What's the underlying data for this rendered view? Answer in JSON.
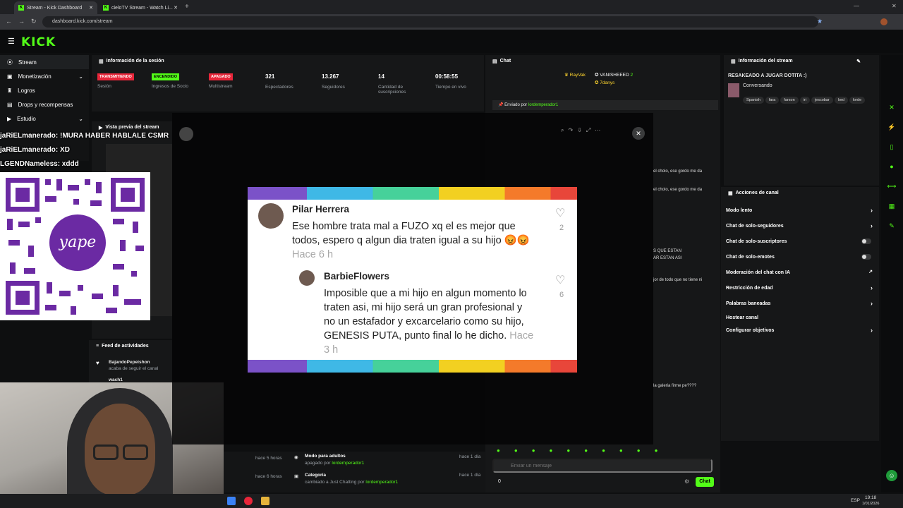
{
  "browser": {
    "tabs": [
      {
        "title": "Stream - Kick Dashboard",
        "active": true
      },
      {
        "title": "cieloTV Stream - Watch Li...",
        "active": false
      }
    ],
    "url": "dashboard.kick.com/stream"
  },
  "header": {
    "logo": "KICK"
  },
  "sidebar": {
    "items": [
      {
        "label": "Stream",
        "icon": "broadcast-icon",
        "active": true
      },
      {
        "label": "Monetización",
        "icon": "money-icon",
        "chevron": "⌄"
      },
      {
        "label": "Logros",
        "icon": "trophy-icon"
      },
      {
        "label": "Drops y recompensas",
        "icon": "gift-icon"
      },
      {
        "label": "Estudio",
        "icon": "video-icon",
        "chevron": "⌄"
      }
    ]
  },
  "session": {
    "title": "Información de la sesión",
    "stats": [
      {
        "value": "TRANSMITIENDO",
        "label": "Sesión",
        "color": "#e8263a"
      },
      {
        "value": "ENCENDIDO",
        "label": "Ingresos de Socio",
        "color": "#53fc18"
      },
      {
        "value": "APAGADO",
        "label": "Multistream",
        "color": "#e8263a"
      },
      {
        "value": "321",
        "label": "Espectadores"
      },
      {
        "value": "13.267",
        "label": "Seguidores"
      },
      {
        "value": "14",
        "label": "Cantidad de suscripciones"
      },
      {
        "value": "00:58:55",
        "label": "Tiempo en vivo"
      }
    ]
  },
  "preview": {
    "title": "Vista previa del stream"
  },
  "overlay_chat": [
    "jaRiELmanerado: !MURA HABER HABLALE CSMR",
    "jaRiELmanerado: XD",
    "LGENDNameless: xddd"
  ],
  "qr": {
    "brand": "yape"
  },
  "activity": {
    "title": "Feed de actividades",
    "items": [
      {
        "user": "BajandoPepeishon",
        "action": "acaba de seguir el canal"
      },
      {
        "user": "wach1",
        "action": ""
      }
    ]
  },
  "chat": {
    "title": "Chat",
    "top_users": [
      {
        "name": "RayVak",
        "count": "3"
      },
      {
        "name": "VANISHEEED",
        "count": "2"
      },
      {
        "name": "7danys",
        "count": "1"
      }
    ],
    "pinned_by_label": "Enviado por",
    "pinned_by_user": "lordemperador1",
    "messages_snippets": [
      "el cholo, ese gordo me da",
      "el cholo, ese gordo me da",
      "S QUE ESTAN",
      "AR ESTAN ASI",
      "jor de todo que no tiene ni",
      "la galeria firme pe????"
    ],
    "input_placeholder": "Enviar un mensaje",
    "send_label": "Chat",
    "count": "0"
  },
  "stream_info": {
    "title": "Información del stream",
    "stream_title": "RESAKEADO A JUGAR DOTITA :)",
    "category": "Conversando",
    "tags": [
      "Spanish",
      "fara",
      "farson",
      "iri",
      "jescobar",
      "lord",
      "lorde"
    ]
  },
  "channel_actions": {
    "title": "Acciones de canal",
    "items": [
      {
        "label": "Modo lento",
        "control": "chevron"
      },
      {
        "label": "Chat de solo-seguidores",
        "control": "chevron"
      },
      {
        "label": "Chat de solo-suscriptores",
        "control": "toggle"
      },
      {
        "label": "Chat de solo-emotes",
        "control": "toggle"
      },
      {
        "label": "Moderación del chat con IA",
        "control": "external"
      },
      {
        "label": "Restricción de edad",
        "control": "chevron"
      },
      {
        "label": "Palabras baneadas",
        "control": "chevron"
      },
      {
        "label": "Hostear canal",
        "control": "none"
      },
      {
        "label": "Configurar objetivos",
        "control": "chevron"
      }
    ]
  },
  "modal": {
    "comments": [
      {
        "user": "Pilar Herrera",
        "text": "Ese hombre trata mal a FUZO xq el es mejor que todos, espero q algun dia traten igual a su hijo",
        "emoji": "😡😡",
        "time": "Hace 6 h",
        "likes": "2"
      },
      {
        "user": "BarbieFlowers",
        "text": "Imposible que a mi hijo en algun momento lo traten asi, mi hijo será un gran profesional y no un estafador y excarcelario como su hijo, GENESIS PUTA, punto final lo he dicho.",
        "time": "Hace 3 h",
        "likes": "6"
      }
    ]
  },
  "bottom_log": [
    {
      "time": "hace 5 horas",
      "title": "Modo para adultos",
      "sub": "apagado por",
      "user": "lordemperador1",
      "when": "hace 1 día"
    },
    {
      "time": "hace 6 horas",
      "title": "Categoría",
      "sub": "cambiado a Just Chatting por",
      "user": "lordemperador1",
      "when": "hace 1 día"
    }
  ],
  "taskbar": {
    "lang": "ESP",
    "time": "19:18",
    "date": "1/01/2026"
  }
}
